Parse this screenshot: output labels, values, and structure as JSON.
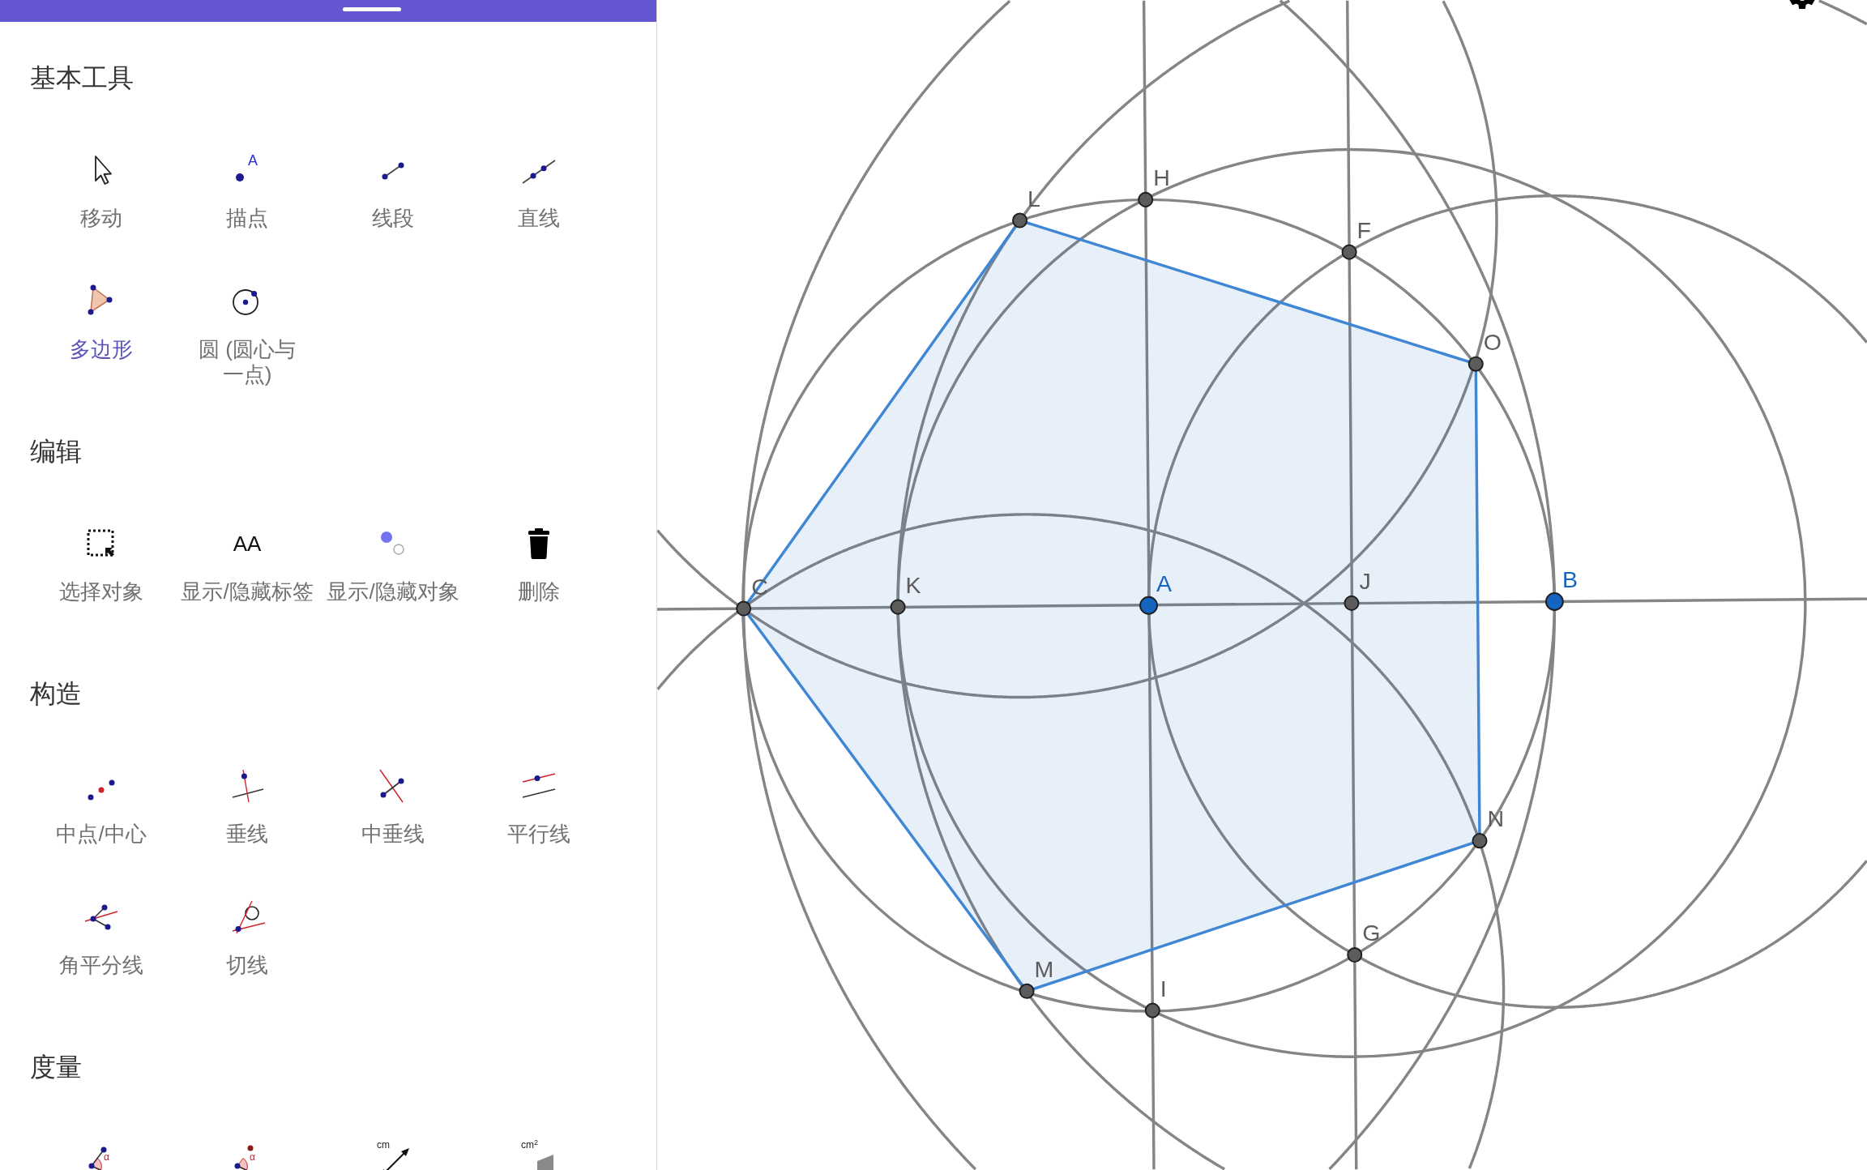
{
  "tool_sections": [
    {
      "title": "基本工具",
      "tools": [
        {
          "kind": "move",
          "label": "移动",
          "selected": false
        },
        {
          "kind": "point",
          "label": "描点",
          "icon_text": "A",
          "selected": false
        },
        {
          "kind": "segment",
          "label": "线段",
          "selected": false
        },
        {
          "kind": "line",
          "label": "直线",
          "selected": false
        },
        {
          "kind": "polygon",
          "label": "多边形",
          "selected": true
        },
        {
          "kind": "circle",
          "label": "圆 (圆心与一点)",
          "selected": false
        }
      ]
    },
    {
      "title": "编辑",
      "tools": [
        {
          "kind": "select",
          "label": "选择对象",
          "selected": false
        },
        {
          "kind": "labels",
          "label": "显示/隐藏标签",
          "icon_text": "AA",
          "selected": false
        },
        {
          "kind": "visibility",
          "label": "显示/隐藏对象",
          "selected": false
        },
        {
          "kind": "delete",
          "label": "删除",
          "selected": false
        }
      ]
    },
    {
      "title": "构造",
      "tools": [
        {
          "kind": "midpoint",
          "label": "中点/中心",
          "selected": false
        },
        {
          "kind": "perpendicular",
          "label": "垂线",
          "selected": false
        },
        {
          "kind": "bisector",
          "label": "中垂线",
          "selected": false
        },
        {
          "kind": "parallel",
          "label": "平行线",
          "selected": false
        },
        {
          "kind": "anglebisector",
          "label": "角平分线",
          "selected": false
        },
        {
          "kind": "tangent",
          "label": "切线",
          "selected": false
        }
      ]
    },
    {
      "title": "度量",
      "tools": [
        {
          "kind": "angle",
          "icon_text": "α"
        },
        {
          "kind": "fixedangle",
          "icon_text": "α"
        },
        {
          "kind": "distance",
          "icon_text": "cm"
        },
        {
          "kind": "area",
          "icon_text": "cm$^{2}$"
        }
      ]
    }
  ],
  "canvas": {
    "points": [
      {
        "label": "H",
        "kind": "dependent",
        "color": "#5c5c5c"
      },
      {
        "label": "L",
        "kind": "dependent",
        "color": "#5c5c5c"
      },
      {
        "label": "F",
        "kind": "dependent",
        "color": "#5c5c5c"
      },
      {
        "label": "O",
        "kind": "dependent",
        "color": "#5c5c5c"
      },
      {
        "label": "C",
        "kind": "dependent",
        "color": "#5c5c5c"
      },
      {
        "label": "K",
        "kind": "dependent",
        "color": "#5c5c5c"
      },
      {
        "label": "A",
        "kind": "free",
        "color": "#1565c0"
      },
      {
        "label": "J",
        "kind": "dependent",
        "color": "#5c5c5c"
      },
      {
        "label": "B",
        "kind": "free",
        "color": "#1565c0"
      },
      {
        "label": "N",
        "kind": "dependent",
        "color": "#5c5c5c"
      },
      {
        "label": "G",
        "kind": "dependent",
        "color": "#5c5c5c"
      },
      {
        "label": "M",
        "kind": "dependent",
        "color": "#5c5c5c"
      },
      {
        "label": "I",
        "kind": "dependent",
        "color": "#5c5c5c"
      }
    ]
  }
}
